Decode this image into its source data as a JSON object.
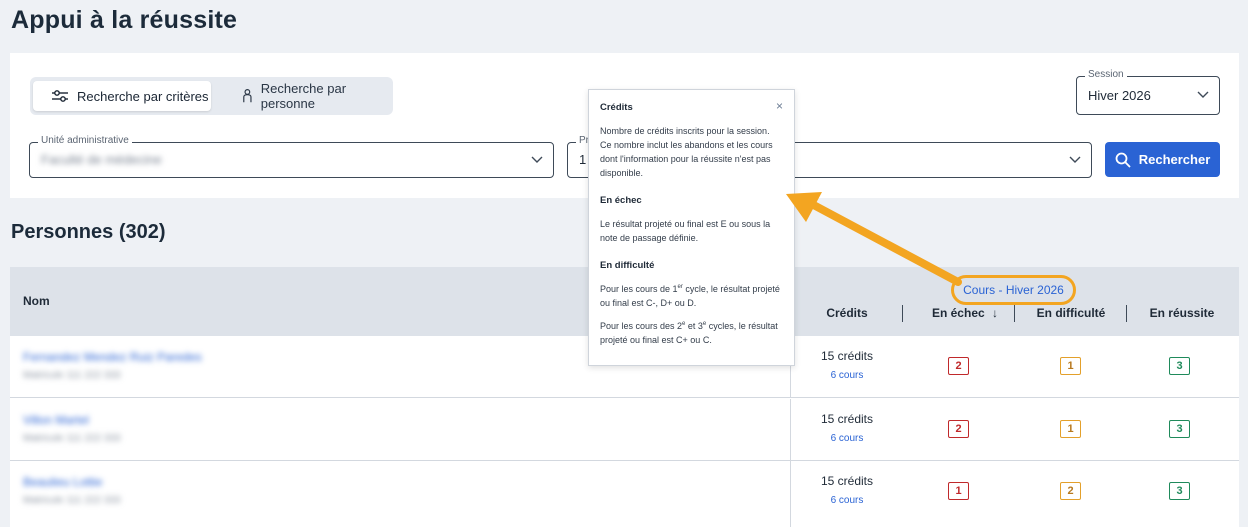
{
  "page": {
    "title": "Appui à la réussite"
  },
  "search": {
    "mode_criteria_label": "Recherche par critères",
    "mode_person_label": "Recherche par personne",
    "session_legend": "Session",
    "session_value": "Hiver 2026",
    "unit_legend": "Unité administrative",
    "unit_value": "Faculté de médecine",
    "prog_legend": "Pr",
    "prog_value": "1",
    "search_button": "Rechercher"
  },
  "persons": {
    "title": "Personnes (302)"
  },
  "table": {
    "name_header": "Nom",
    "group_header": "Cours - Hiver 2026",
    "columns": [
      "Crédits",
      "En échec",
      "En difficulté",
      "En réussite"
    ],
    "sort_indicator": "↓",
    "rows": [
      {
        "name": "Fernandez Mendez Ruiz Paredes",
        "sub": "Matricule 111 222 333",
        "credits": "15 crédits",
        "courses": "6 cours",
        "fail": "2",
        "difficulty": "1",
        "success": "3"
      },
      {
        "name": "Villon Martel",
        "sub": "Matricule 111 222 333",
        "credits": "15 crédits",
        "courses": "6 cours",
        "fail": "2",
        "difficulty": "1",
        "success": "3"
      },
      {
        "name": "Beaulieu Lottie",
        "sub": "Matricule 111 222 333",
        "credits": "15 crédits",
        "courses": "6 cours",
        "fail": "1",
        "difficulty": "2",
        "success": "3"
      }
    ]
  },
  "tooltip": {
    "close": "×",
    "credits_title": "Crédits",
    "credits_text": "Nombre de crédits inscrits pour la session. Ce nombre inclut les abandons et les cours dont l'information pour la réussite n'est pas disponible.",
    "fail_title": "En échec",
    "fail_text": "Le résultat projeté ou final est E ou sous la note de passage définie.",
    "difficulty_title": "En difficulté",
    "diff_p1_a": "Pour les cours de 1",
    "diff_p1_sup": "er",
    "diff_p1_b": " cycle, le résultat projeté ou final est C-, D+ ou D.",
    "diff_p2_a": "Pour les cours des 2",
    "diff_p2_sup1": "e",
    "diff_p2_b": " et 3",
    "diff_p2_sup2": "e",
    "diff_p2_c": " cycles, le résultat projeté ou final est C+ ou C."
  },
  "colors": {
    "accent": "#2a63d4",
    "highlight": "#f3a521",
    "fail": "#c0292b",
    "difficulty": "#e3a02b",
    "success": "#1f8a5b"
  }
}
